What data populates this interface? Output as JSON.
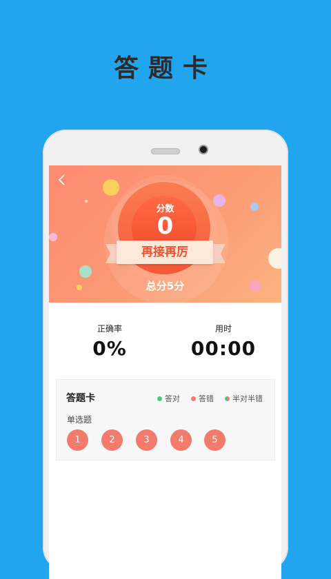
{
  "promo": {
    "title": "答题卡"
  },
  "score": {
    "label": "分数",
    "value": "0",
    "encouragement": "再接再厉",
    "total": "总分5分"
  },
  "stats": {
    "accuracy_label": "正确率",
    "accuracy_value": "0%",
    "time_label": "用时",
    "time_value": "00:00"
  },
  "answer_card": {
    "title": "答题卡",
    "legend": [
      {
        "label": "答对",
        "color": "#4cc48a"
      },
      {
        "label": "答错",
        "color": "#f27b6c"
      },
      {
        "label": "半对半错",
        "color": "#f27b6c"
      }
    ],
    "section_label": "单选题",
    "questions": [
      "1",
      "2",
      "3",
      "4",
      "5"
    ]
  },
  "colors": {
    "background": "#21a5ef",
    "header_gradient_start": "#fc8a6f",
    "wrong": "#f27b6c",
    "correct": "#4cc48a"
  },
  "icons": {
    "back": "chevron-left-icon"
  }
}
